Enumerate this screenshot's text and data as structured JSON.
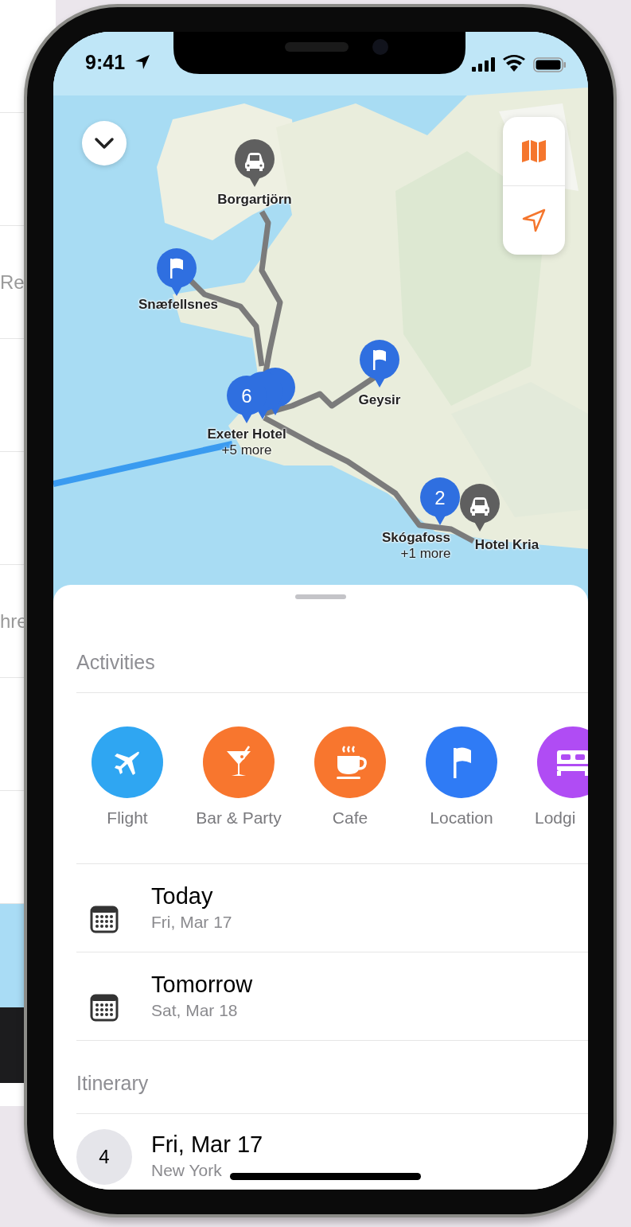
{
  "background_screen": {
    "texts": [
      "Re",
      "hre"
    ]
  },
  "status_bar": {
    "time": "9:41"
  },
  "map": {
    "pins": [
      {
        "kind": "car",
        "label": "Borgartjörn"
      },
      {
        "kind": "flag",
        "label": "Snæfellsnes"
      },
      {
        "kind": "flag",
        "label": "Geysir"
      },
      {
        "kind": "cluster",
        "count": "6",
        "label": "Exeter Hotel",
        "sublabel": "+5 more"
      },
      {
        "kind": "cluster",
        "count": "2",
        "label": "Skógafoss",
        "sublabel": "+1 more"
      },
      {
        "kind": "car",
        "label": "Hotel Kria"
      }
    ]
  },
  "activities": {
    "title": "Activities",
    "items": [
      {
        "kind": "flight",
        "label": "Flight",
        "color": "#2fa6f2"
      },
      {
        "kind": "bar",
        "label": "Bar & Party",
        "color": "#f8762e"
      },
      {
        "kind": "cafe",
        "label": "Cafe",
        "color": "#f8762e"
      },
      {
        "kind": "location",
        "label": "Location",
        "color": "#2f7bf5"
      },
      {
        "kind": "lodging",
        "label": "Lodgi",
        "color": "#b04cf4"
      }
    ]
  },
  "dates": [
    {
      "title": "Today",
      "subtitle": "Fri, Mar 17"
    },
    {
      "title": "Tomorrow",
      "subtitle": "Sat, Mar 18"
    }
  ],
  "itinerary": {
    "title": "Itinerary",
    "days": [
      {
        "count": "4",
        "title": "Fri, Mar 17",
        "subtitle": "New York"
      }
    ]
  }
}
